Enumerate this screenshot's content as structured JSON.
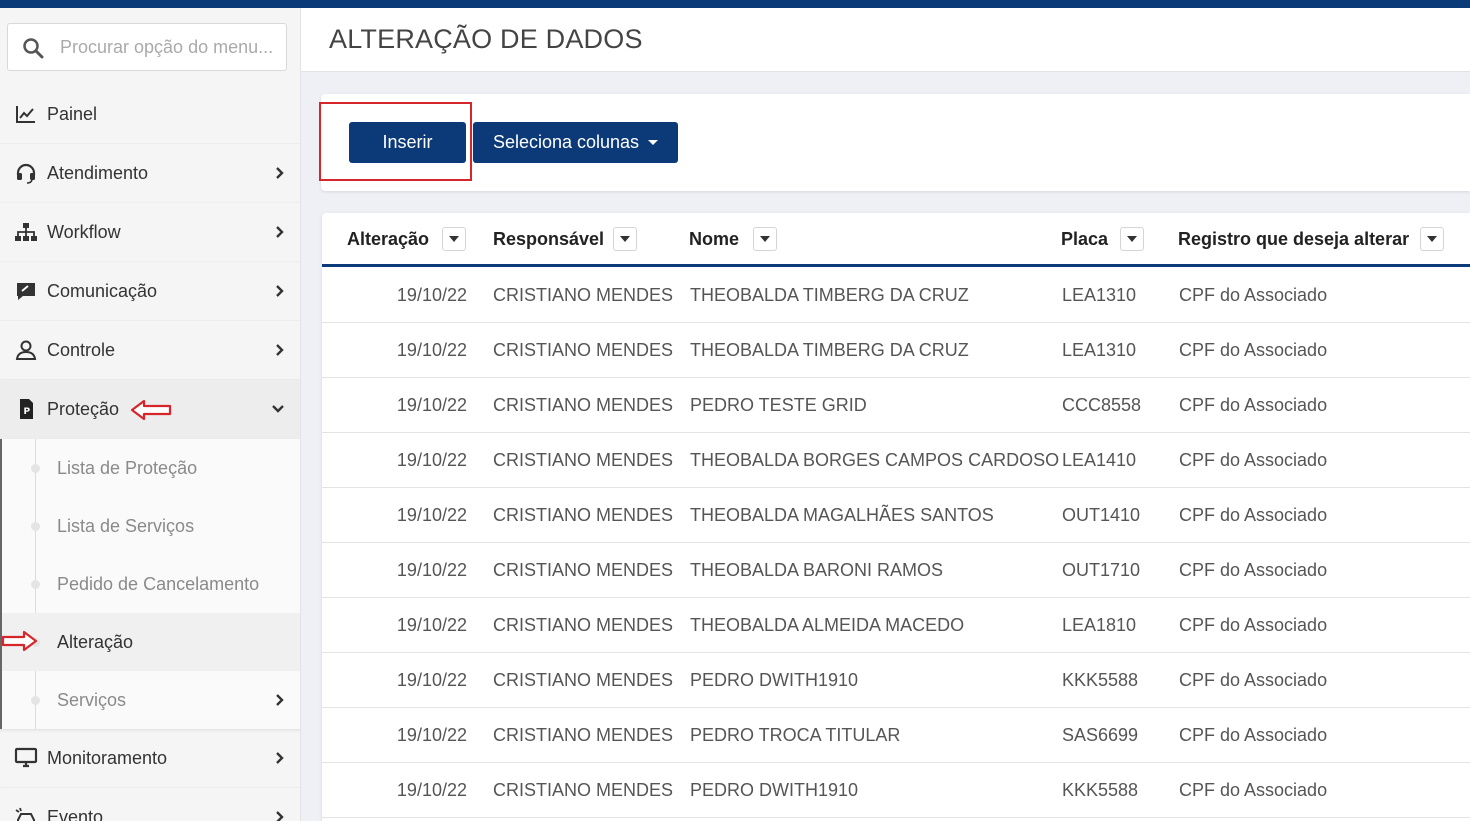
{
  "search": {
    "placeholder": "Procurar opção do menu..."
  },
  "sidebar": {
    "items": [
      {
        "label": "Painel",
        "icon": "chart-line-icon",
        "chevron": false
      },
      {
        "label": "Atendimento",
        "icon": "headset-icon",
        "chevron": true
      },
      {
        "label": "Workflow",
        "icon": "sitemap-icon",
        "chevron": true
      },
      {
        "label": "Comunicação",
        "icon": "chat-icon",
        "chevron": true
      },
      {
        "label": "Controle",
        "icon": "user-icon",
        "chevron": true
      },
      {
        "label": "Proteção",
        "icon": "document-p-icon",
        "chevron": true,
        "expanded": true
      }
    ],
    "subitems": [
      {
        "label": "Lista de Proteção"
      },
      {
        "label": "Lista de Serviços"
      },
      {
        "label": "Pedido de Cancelamento"
      },
      {
        "label": "Alteração",
        "current": true
      },
      {
        "label": "Serviços",
        "chevron": true
      }
    ],
    "after_items": [
      {
        "label": "Monitoramento",
        "icon": "monitor-icon",
        "chevron": true
      },
      {
        "label": "Evento",
        "icon": "car-crash-icon",
        "chevron": true
      }
    ]
  },
  "page": {
    "title": "ALTERAÇÃO DE DADOS"
  },
  "toolbar": {
    "insert_label": "Inserir",
    "columns_label": "Seleciona colunas"
  },
  "table": {
    "headers": [
      "Alteração",
      "Responsável",
      "Nome",
      "Placa",
      "Registro que deseja alterar"
    ],
    "rows": [
      [
        "19/10/22",
        "CRISTIANO MENDES",
        "THEOBALDA TIMBERG DA CRUZ",
        "LEA1310",
        "CPF do Associado"
      ],
      [
        "19/10/22",
        "CRISTIANO MENDES",
        "THEOBALDA TIMBERG DA CRUZ",
        "LEA1310",
        "CPF do Associado"
      ],
      [
        "19/10/22",
        "CRISTIANO MENDES",
        "PEDRO TESTE GRID",
        "CCC8558",
        "CPF do Associado"
      ],
      [
        "19/10/22",
        "CRISTIANO MENDES",
        "THEOBALDA BORGES CAMPOS CARDOSO",
        "LEA1410",
        "CPF do Associado"
      ],
      [
        "19/10/22",
        "CRISTIANO MENDES",
        "THEOBALDA MAGALHÃES SANTOS",
        "OUT1410",
        "CPF do Associado"
      ],
      [
        "19/10/22",
        "CRISTIANO MENDES",
        "THEOBALDA BARONI RAMOS",
        "OUT1710",
        "CPF do Associado"
      ],
      [
        "19/10/22",
        "CRISTIANO MENDES",
        "THEOBALDA ALMEIDA MACEDO",
        "LEA1810",
        "CPF do Associado"
      ],
      [
        "19/10/22",
        "CRISTIANO MENDES",
        "PEDRO DWITH1910",
        "KKK5588",
        "CPF do Associado"
      ],
      [
        "19/10/22",
        "CRISTIANO MENDES",
        "PEDRO TROCA TITULAR",
        "SAS6699",
        "CPF do Associado"
      ],
      [
        "19/10/22",
        "CRISTIANO MENDES",
        "PEDRO DWITH1910",
        "KKK5588",
        "CPF do Associado"
      ]
    ]
  },
  "colors": {
    "brand": "#0c3a78",
    "highlight": "#d7262b"
  }
}
